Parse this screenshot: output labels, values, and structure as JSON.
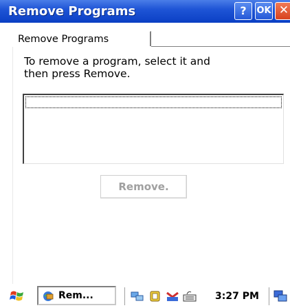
{
  "window": {
    "title": "Remove Programs",
    "help_label": "?",
    "ok_label": "OK",
    "close_label": "✕"
  },
  "tabs": [
    {
      "label": "Remove Programs",
      "selected": true
    }
  ],
  "main": {
    "instructions": "To remove a program, select it and\nthen press Remove.",
    "program_list": [],
    "remove_button_label": "Remove.",
    "remove_button_enabled": false
  },
  "taskbar": {
    "start_icon": "windows-flag-icon",
    "task_label": "Rem...",
    "task_icon": "remove-programs-icon",
    "tray_icons": [
      "network-icon",
      "battery-icon",
      "input-icon",
      "keyboard-icon"
    ],
    "clock": "3:27 PM",
    "desktop_icon": "show-desktop-icon"
  },
  "colors": {
    "titlebar": "#1f55d6",
    "close_button": "#d8421e",
    "disabled_text": "#a0a0a0"
  }
}
